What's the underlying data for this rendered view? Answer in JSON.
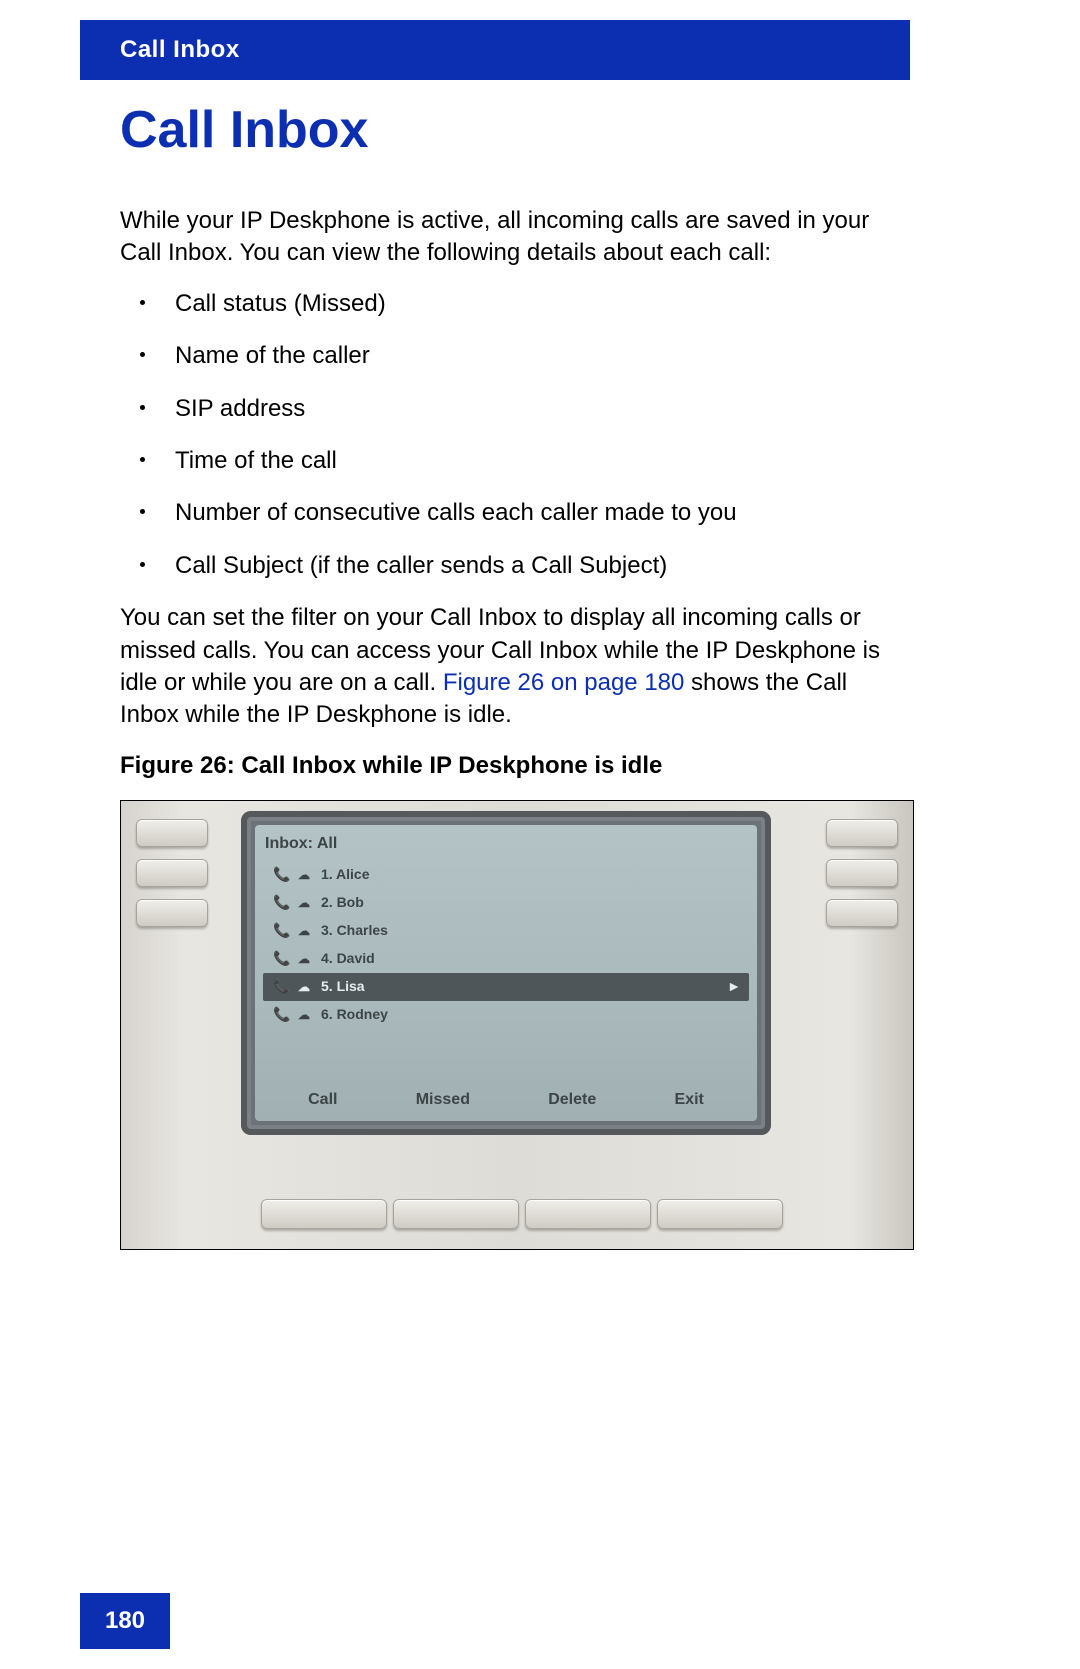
{
  "header": {
    "section": "Call Inbox"
  },
  "title": "Call Inbox",
  "intro": "While your IP Deskphone is active, all incoming calls are saved in your Call Inbox. You can view the following details about each call:",
  "bullets": [
    "Call status (Missed)",
    "Name of the caller",
    "SIP address",
    "Time of the call",
    "Number of consecutive calls each caller made to you",
    "Call Subject (if the caller sends a Call Subject)"
  ],
  "para2_a": "You can set the filter on your Call Inbox to display all incoming calls or missed calls. You can access your Call Inbox while the IP Deskphone is idle or while you are on a call. ",
  "para2_link": "Figure 26 on page 180",
  "para2_b": " shows the Call Inbox while the IP Deskphone is idle.",
  "figure_caption": "Figure 26: Call Inbox while IP Deskphone is idle",
  "phone": {
    "screen_title": "Inbox: All",
    "items": [
      {
        "num": "1.",
        "name": "Alice",
        "selected": false
      },
      {
        "num": "2.",
        "name": "Bob",
        "selected": false
      },
      {
        "num": "3.",
        "name": "Charles",
        "selected": false
      },
      {
        "num": "4.",
        "name": "David",
        "selected": false
      },
      {
        "num": "5.",
        "name": "Lisa",
        "selected": true
      },
      {
        "num": "6.",
        "name": "Rodney",
        "selected": false
      }
    ],
    "softkeys": {
      "k1": "Call",
      "k2": "Missed",
      "k3": "Delete",
      "k4": "Exit"
    },
    "icons": {
      "handset": "📞",
      "voicemail": "☁",
      "arrow": "►"
    }
  },
  "page_number": "180"
}
